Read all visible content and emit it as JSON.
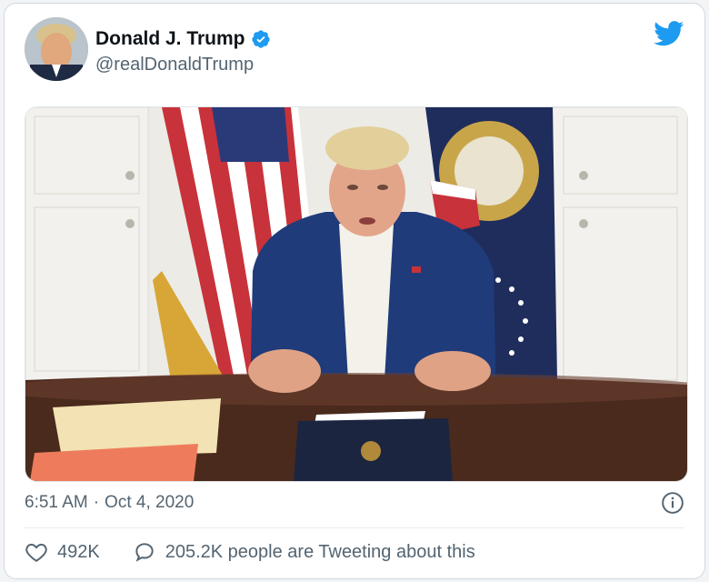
{
  "tweet": {
    "author_name": "Donald J. Trump",
    "author_handle": "@realDonaldTrump",
    "time": "6:51 AM",
    "separator": "·",
    "date": "Oct 4, 2020",
    "likes": "492K",
    "conversation": "205.2K people are Tweeting about this"
  },
  "icons": {
    "brand": "twitter-bird-icon",
    "verified": "verified-badge-icon",
    "info": "info-icon",
    "like": "heart-icon",
    "reply": "speech-bubble-icon"
  },
  "colors": {
    "twitter_blue": "#1d9bf0",
    "text_primary": "#0f1419",
    "text_secondary": "#536471"
  }
}
